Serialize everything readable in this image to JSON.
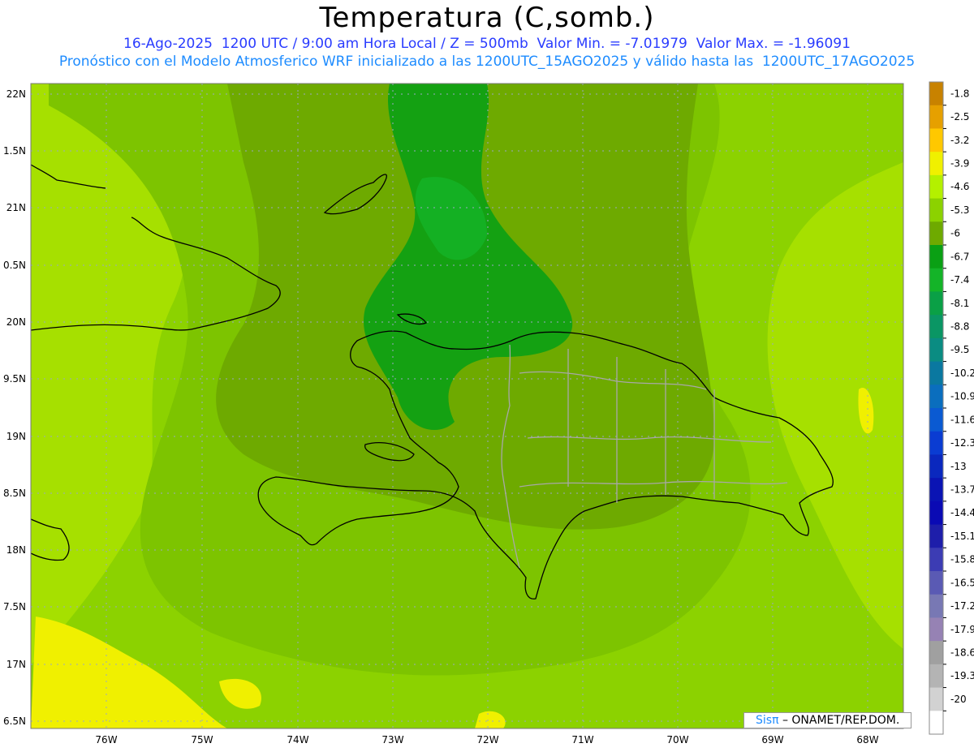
{
  "header": {
    "title": "Temperatura (C,somb.)",
    "subtitle1": "16-Ago-2025  1200 UTC / 9:00 am Hora Local / Z = 500mb  Valor Min. = -7.01979  Valor Max. = -1.96091",
    "subtitle2": "Pronóstico con el Modelo Atmosferico WRF inicializado a las 1200UTC_15AGO2025 y válido hasta las  1200UTC_17AGO2025"
  },
  "map": {
    "lat_labels": [
      "22N",
      "1.5N",
      "21N",
      "0.5N",
      "20N",
      "9.5N",
      "19N",
      "8.5N",
      "18N",
      "7.5N",
      "17N",
      "6.5N"
    ],
    "lon_labels": [
      "76W",
      "75W",
      "74W",
      "73W",
      "72W",
      "71W",
      "70W",
      "69W",
      "68W"
    ],
    "grid_lines": true,
    "field": "temperature",
    "range": [
      -7.01979,
      -1.96091
    ]
  },
  "colorbar": {
    "labels": [
      "-1.8",
      "-2.5",
      "-3.2",
      "-3.9",
      "-4.6",
      "-5.3",
      "-6",
      "-6.7",
      "-7.4",
      "-8.1",
      "-8.8",
      "-9.5",
      "-10.2",
      "-10.9",
      "-11.6",
      "-12.3",
      "-13",
      "-13.7",
      "-14.4",
      "-15.1",
      "-15.8",
      "-16.5",
      "-17.2",
      "-17.9",
      "-18.6",
      "-19.3",
      "-20"
    ],
    "colors": [
      "#c88200",
      "#e6a000",
      "#ffc800",
      "#f0f000",
      "#b4f000",
      "#8cd200",
      "#6eaa00",
      "#0aa014",
      "#14b428",
      "#0aa046",
      "#0a9664",
      "#0a8c82",
      "#0a78a0",
      "#0a6ebe",
      "#0a5ad2",
      "#0a3cd2",
      "#0a28be",
      "#0a14b4",
      "#0a0ab4",
      "#1e1eaa",
      "#3c3cb4",
      "#5a5ab4",
      "#7878b4",
      "#9682b4",
      "#a0a0a0",
      "#b4b4b4",
      "#d2d2d2",
      "#ffffff"
    ]
  },
  "credit": {
    "brand": "Sisπ",
    "org": " – ONAMET/REP.DOM."
  }
}
